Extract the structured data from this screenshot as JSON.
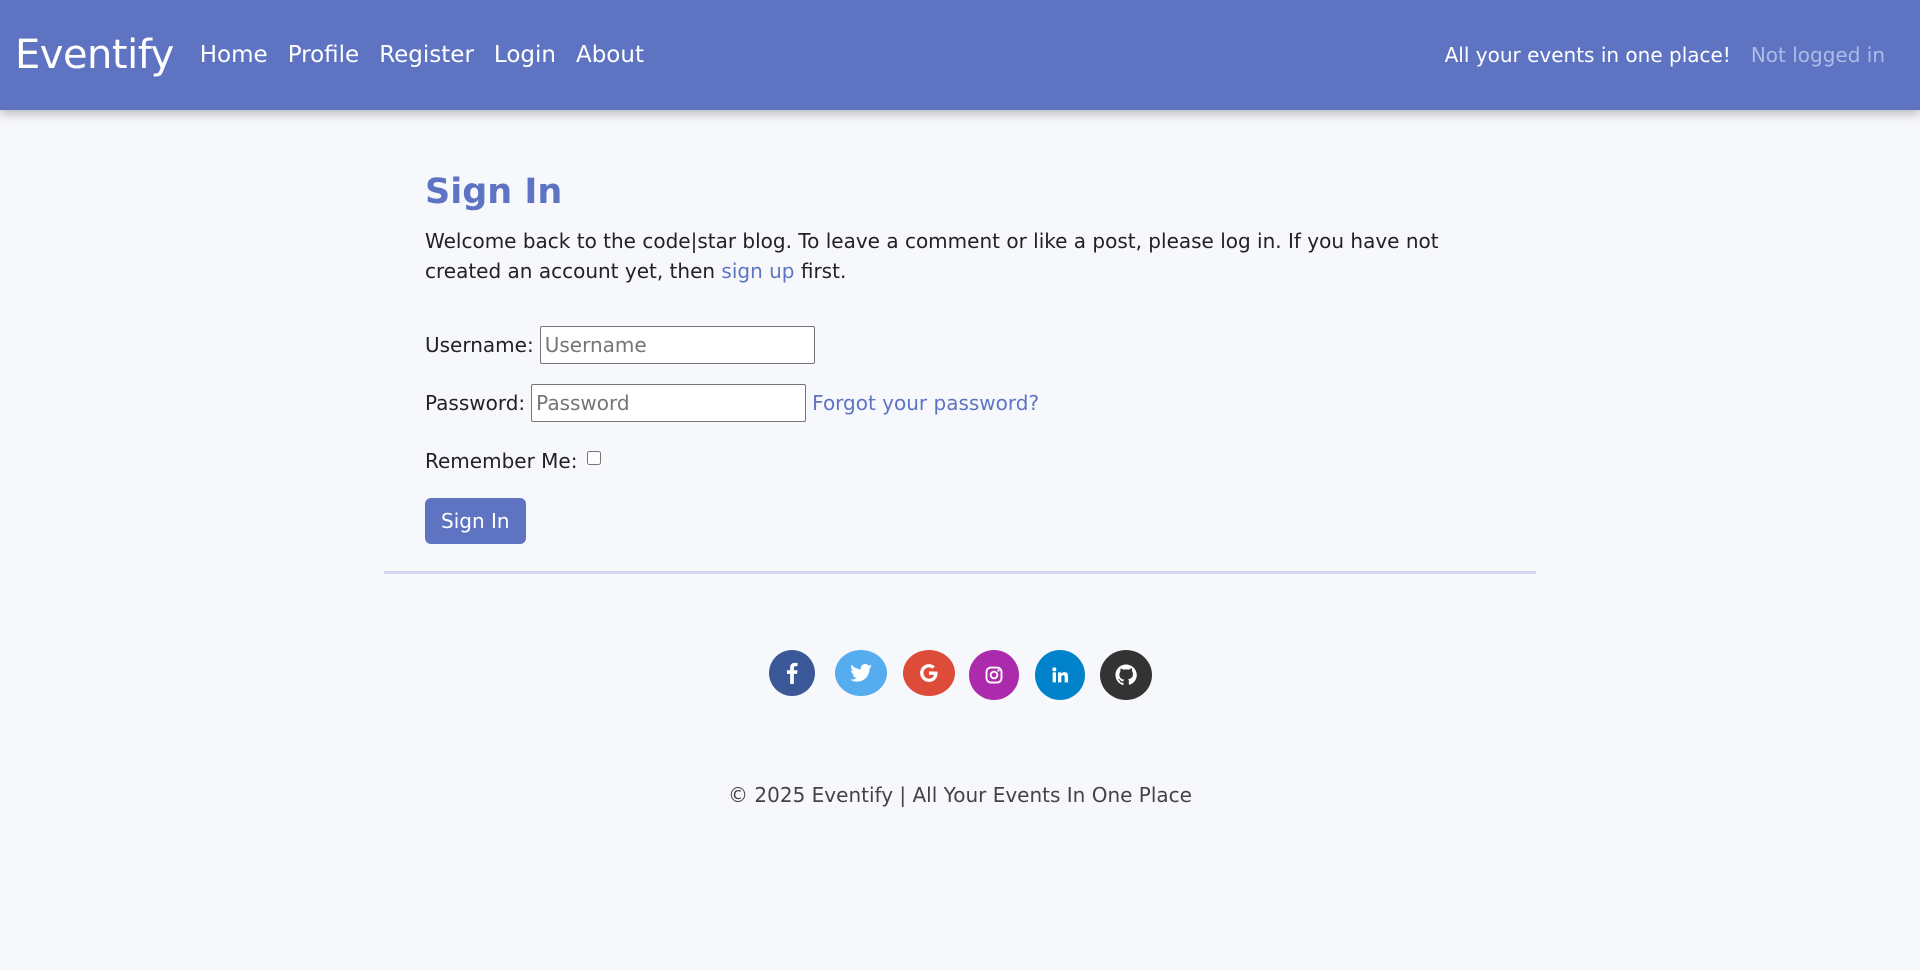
{
  "navbar": {
    "brand": "Eventify",
    "links": [
      {
        "label": "Home"
      },
      {
        "label": "Profile"
      },
      {
        "label": "Register"
      },
      {
        "label": "Login"
      },
      {
        "label": "About"
      }
    ],
    "tagline": "All your events in one place!",
    "login_status": "Not logged in"
  },
  "main": {
    "title": "Sign In",
    "intro_before": "Welcome back to the code|star blog. To leave a comment or like a post, please log in. If you have not created an account yet, then ",
    "intro_link": "sign up",
    "intro_after": " first.",
    "username_label": "Username:",
    "username_placeholder": "Username",
    "username_value": "",
    "password_label": "Password:",
    "password_placeholder": "Password",
    "password_value": "",
    "forgot_link": "Forgot your password?",
    "remember_label": "Remember Me:",
    "remember_checked": false,
    "submit_label": "Sign In"
  },
  "socials": [
    {
      "name": "facebook",
      "icon": "facebook-icon",
      "color": "#3b5998"
    },
    {
      "name": "twitter",
      "icon": "twitter-icon",
      "color": "#55acee"
    },
    {
      "name": "google",
      "icon": "google-icon",
      "color": "#dd4b39"
    },
    {
      "name": "instagram",
      "icon": "instagram-icon",
      "color": "#ac2bac"
    },
    {
      "name": "linkedin",
      "icon": "linkedin-icon",
      "color": "#0082ca"
    },
    {
      "name": "github",
      "icon": "github-icon",
      "color": "#333333"
    }
  ],
  "footer": {
    "text": "© 2025 Eventify | All Your Events In One Place"
  },
  "colors": {
    "primary": "#5e74c3",
    "background": "#f7f8fc",
    "divider": "#d4d6f3"
  }
}
